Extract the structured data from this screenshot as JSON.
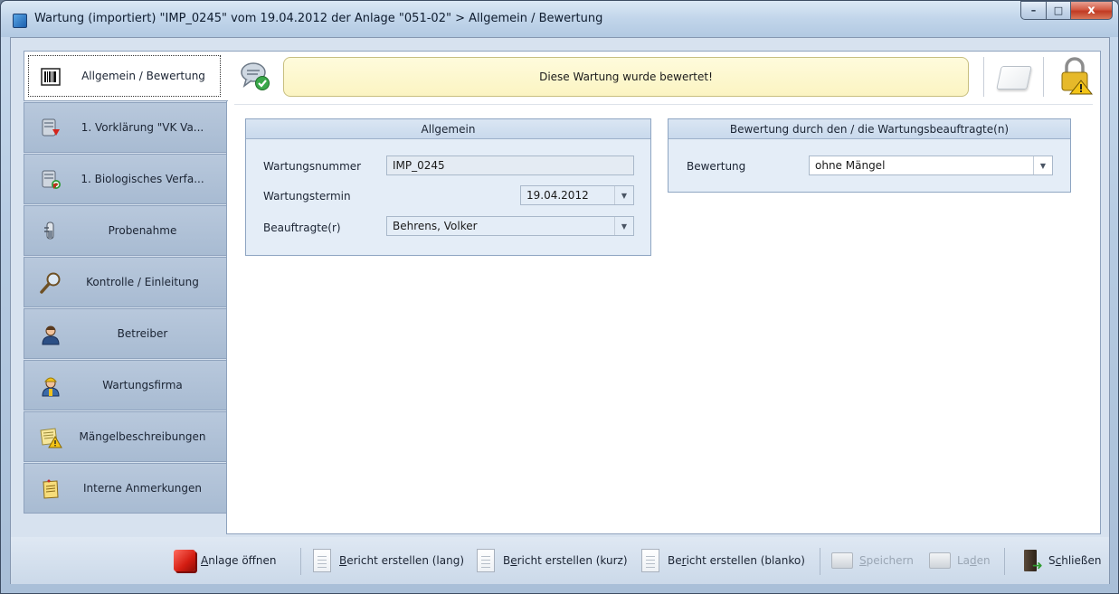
{
  "window": {
    "title": "Wartung (importiert) \"IMP_0245\" vom 19.04.2012 der Anlage \"051-02\" > Allgemein / Bewertung",
    "controls": {
      "minimize": "–",
      "maximize": "□",
      "close": "x"
    }
  },
  "sidebar": {
    "items": [
      {
        "label": "Allgemein / Bewertung",
        "icon": "barcode-icon",
        "active": true
      },
      {
        "label": "1. Vorklärung \"VK Va...",
        "icon": "server-down-icon",
        "active": false
      },
      {
        "label": "1. Biologisches Verfa...",
        "icon": "server-refresh-icon",
        "active": false
      },
      {
        "label": "Probenahme",
        "icon": "sample-tube-icon",
        "active": false
      },
      {
        "label": "Kontrolle / Einleitung",
        "icon": "magnifier-icon",
        "active": false
      },
      {
        "label": "Betreiber",
        "icon": "user-icon",
        "active": false
      },
      {
        "label": "Wartungsfirma",
        "icon": "worker-icon",
        "active": false
      },
      {
        "label": "Mängelbeschreibungen",
        "icon": "warning-note-icon",
        "active": false
      },
      {
        "label": "Interne Anmerkungen",
        "icon": "notepad-icon",
        "active": false
      }
    ]
  },
  "banner": {
    "message": "Diese Wartung wurde bewertet!",
    "status_icon": "chat-check-icon",
    "note_icon": "blank-note-icon",
    "lock_icon": "lock-warning-icon"
  },
  "general": {
    "title": "Allgemein",
    "wartungsnummer_label": "Wartungsnummer",
    "wartungsnummer_value": "IMP_0245",
    "wartungstermin_label": "Wartungstermin",
    "wartungstermin_value": "19.04.2012",
    "beauftragte_label": "Beauftragte(r)",
    "beauftragte_value": "Behrens, Volker"
  },
  "rating": {
    "title": "Bewertung durch den / die Wartungsbeauftragte(n)",
    "bewertung_label": "Bewertung",
    "bewertung_value": "ohne Mängel"
  },
  "toolbar": {
    "anlage_oeffnen": {
      "mnemonic": "A",
      "rest": "nlage öffnen"
    },
    "bericht_lang": {
      "mnemonic": "B",
      "rest": "ericht erstellen (lang)"
    },
    "bericht_kurz": {
      "prefix": "B",
      "mnemonic": "e",
      "rest": "richt erstellen (kurz)"
    },
    "bericht_blanko": {
      "prefix": "Be",
      "mnemonic": "r",
      "rest": "icht erstellen (blanko)"
    },
    "speichern": {
      "mnemonic": "S",
      "rest": "peichern"
    },
    "laden": {
      "prefix": "La",
      "mnemonic": "d",
      "rest": "en"
    },
    "schliessen": {
      "prefix": "S",
      "mnemonic": "c",
      "rest": "hließen"
    }
  },
  "colors": {
    "banner_background": "#fbf4c2",
    "group_background": "#e4edf7",
    "sidebar_background": "#a8bbd2"
  }
}
